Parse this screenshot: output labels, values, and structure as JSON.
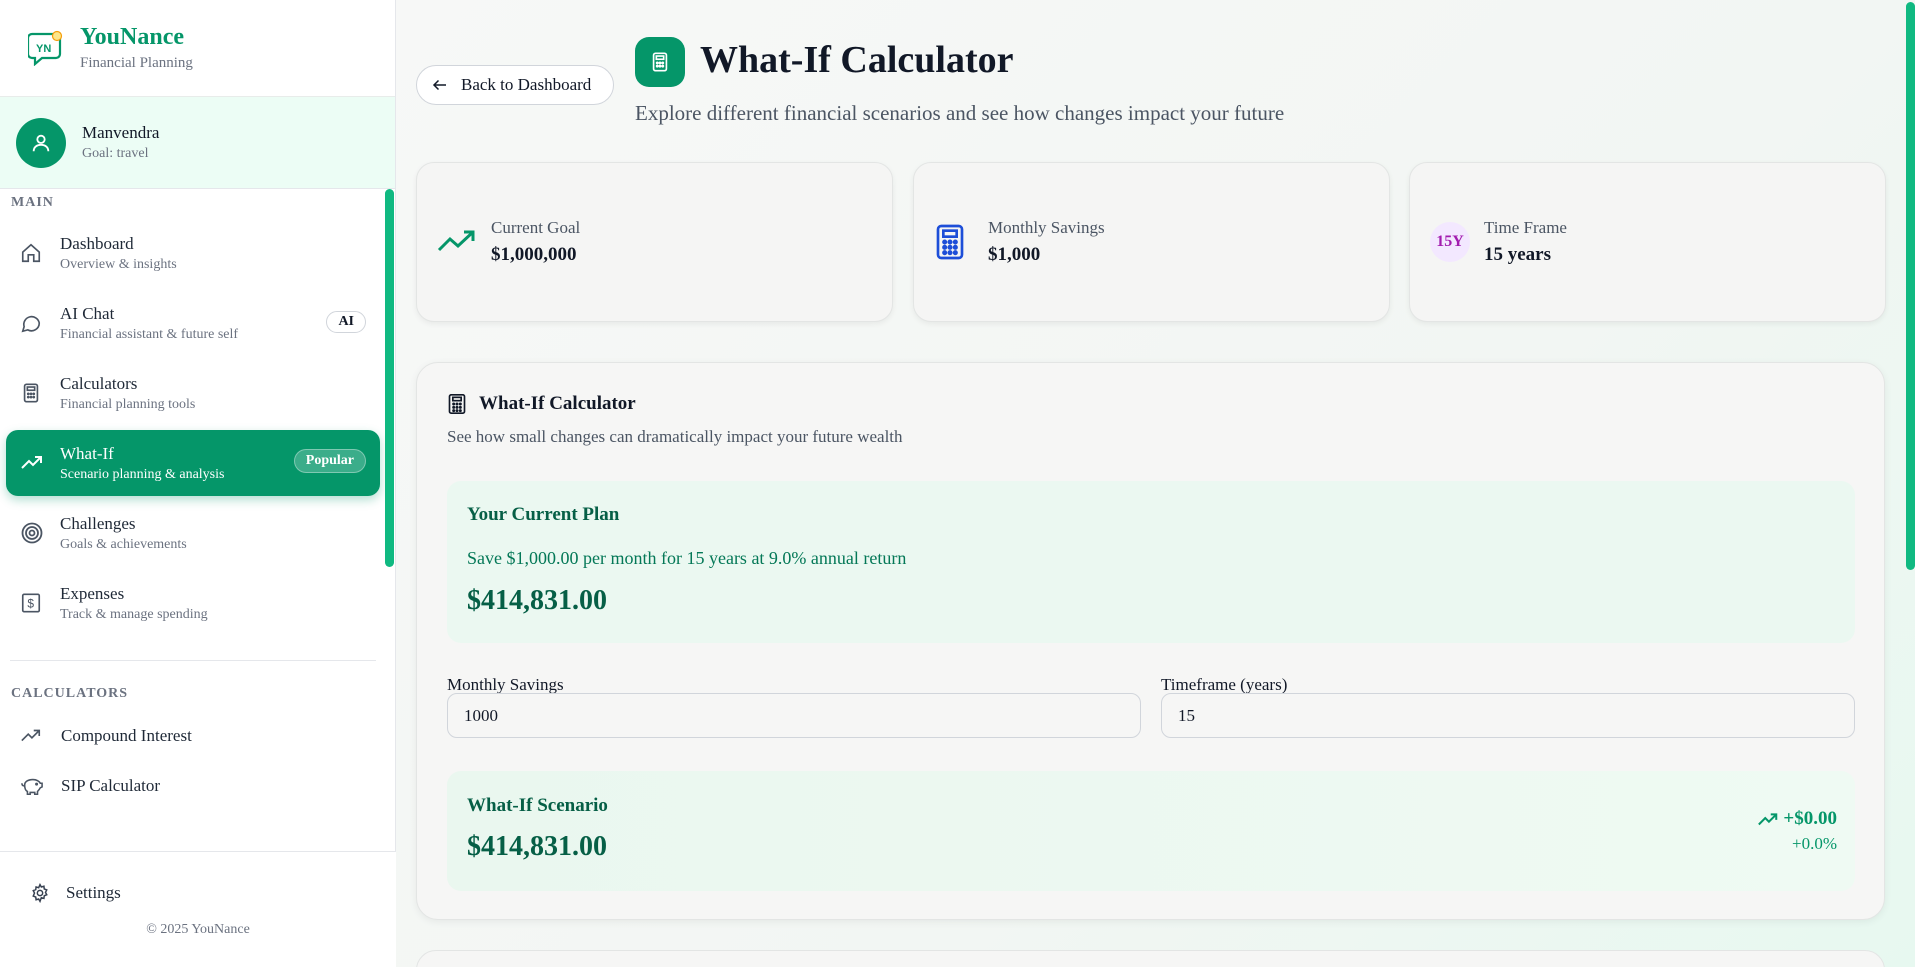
{
  "brand": {
    "name": "YouNance",
    "tagline": "Financial Planning",
    "logo_text": "YN"
  },
  "user": {
    "name": "Manvendra",
    "goal": "Goal: travel"
  },
  "nav": {
    "main_label": "MAIN",
    "items": [
      {
        "title": "Dashboard",
        "subtitle": "Overview & insights",
        "icon": "home-icon"
      },
      {
        "title": "AI Chat",
        "subtitle": "Financial assistant & future self",
        "icon": "chat-icon",
        "badge": "AI"
      },
      {
        "title": "Calculators",
        "subtitle": "Financial planning tools",
        "icon": "calculator-icon"
      },
      {
        "title": "What-If",
        "subtitle": "Scenario planning & analysis",
        "icon": "trending-up-icon",
        "badge": "Popular",
        "active": true
      },
      {
        "title": "Challenges",
        "subtitle": "Goals & achievements",
        "icon": "target-icon"
      },
      {
        "title": "Expenses",
        "subtitle": "Track & manage spending",
        "icon": "dollar-receipt-icon"
      }
    ],
    "calculators_label": "CALCULATORS",
    "calculators": [
      {
        "title": "Compound Interest",
        "icon": "trending-up-icon"
      },
      {
        "title": "SIP Calculator",
        "icon": "piggy-bank-icon"
      }
    ],
    "settings": "Settings",
    "copyright": "© 2025 YouNance"
  },
  "header": {
    "back_label": "Back to Dashboard",
    "title": "What-If Calculator",
    "subtitle": "Explore different financial scenarios and see how changes impact your future"
  },
  "stats": [
    {
      "label": "Current Goal",
      "value": "$1,000,000",
      "icon": "trending-up-icon"
    },
    {
      "label": "Monthly Savings",
      "value": "$1,000",
      "icon": "calculator-icon"
    },
    {
      "label": "Time Frame",
      "value": "15 years",
      "badge": "15Y"
    }
  ],
  "calculator": {
    "title": "What-If Calculator",
    "subtitle": "See how small changes can dramatically impact your future wealth",
    "current_plan": {
      "title": "Your Current Plan",
      "description": "Save $1,000.00 per month for 15 years at 9.0% annual return",
      "value": "$414,831.00"
    },
    "fields": {
      "monthly_label": "Monthly Savings",
      "monthly_value": "1000",
      "timeframe_label": "Timeframe (years)",
      "timeframe_value": "15"
    },
    "scenario": {
      "title": "What-If Scenario",
      "value": "$414,831.00",
      "delta": "+$0.00",
      "delta_pct": "+0.0%"
    }
  },
  "colors": {
    "accent": "#059669",
    "accent_light": "#ecfdf5",
    "text": "#111827",
    "muted": "#6b7280",
    "blue": "#1d4ed8",
    "purple": "#a21caf"
  }
}
